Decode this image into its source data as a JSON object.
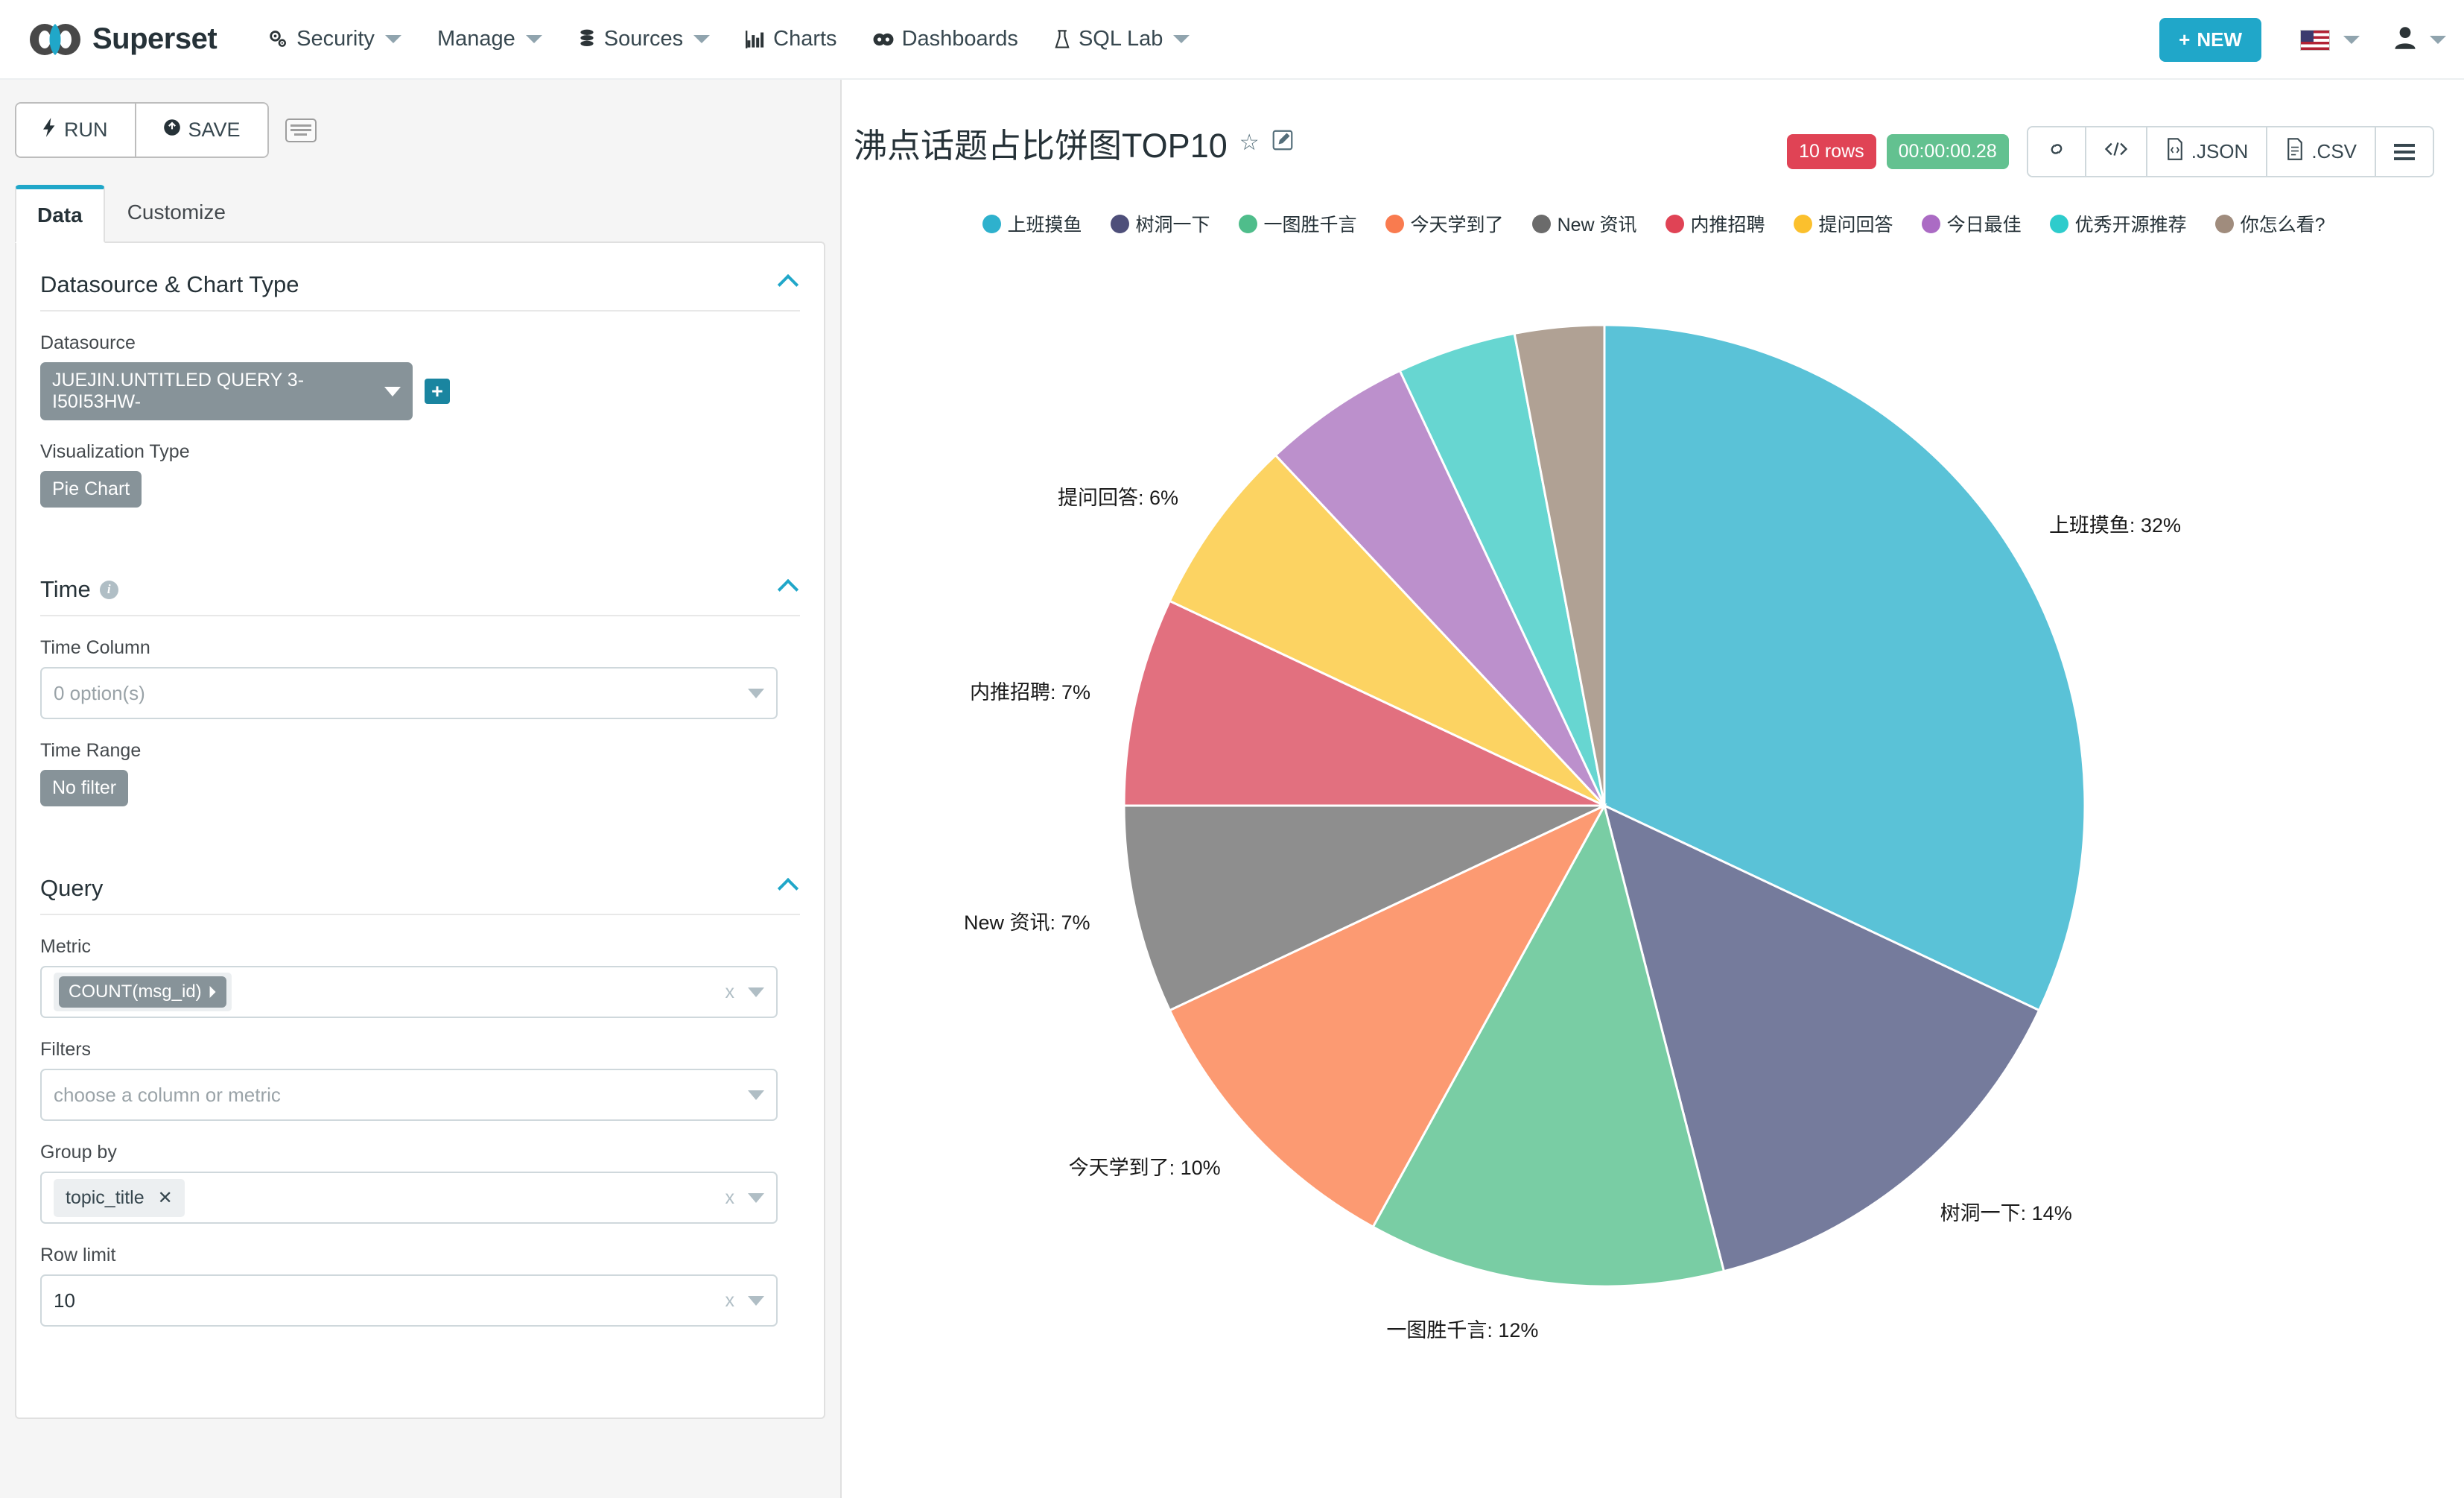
{
  "navbar": {
    "brand": "Superset",
    "items": [
      {
        "label": "Security",
        "icon": "gears-icon",
        "caret": true
      },
      {
        "label": "Manage",
        "icon": null,
        "caret": true
      },
      {
        "label": "Sources",
        "icon": "database-icon",
        "caret": true
      },
      {
        "label": "Charts",
        "icon": "bar-chart-icon",
        "caret": false
      },
      {
        "label": "Dashboards",
        "icon": "dashboard-icon",
        "caret": false
      },
      {
        "label": "SQL Lab",
        "icon": "flask-icon",
        "caret": true
      }
    ],
    "new_button": "NEW",
    "new_button_plus": "+",
    "language_icon": "us-flag-icon",
    "user_icon": "person-icon"
  },
  "left_panel": {
    "run_label": "RUN",
    "save_label": "SAVE",
    "keyboard_shortcut_icon": "keyboard-icon",
    "tabs": [
      {
        "label": "Data",
        "active": true
      },
      {
        "label": "Customize",
        "active": false
      }
    ],
    "sections": {
      "datasource": {
        "title": "Datasource & Chart Type",
        "datasource_label": "Datasource",
        "datasource_value": "JUEJIN.UNTITLED QUERY 3-I50I53HW-",
        "add_datasource_icon": "+",
        "viz_type_label": "Visualization Type",
        "viz_type_value": "Pie Chart"
      },
      "time": {
        "title": "Time",
        "time_column_label": "Time Column",
        "time_column_value": "0 option(s)",
        "time_range_label": "Time Range",
        "time_range_value": "No filter"
      },
      "query": {
        "title": "Query",
        "metric_label": "Metric",
        "metric_value": "COUNT(msg_id)",
        "filters_label": "Filters",
        "filters_placeholder": "choose a column or metric",
        "group_by_label": "Group by",
        "group_by_value": "topic_title",
        "row_limit_label": "Row limit",
        "row_limit_value": "10",
        "clear_x": "x"
      }
    }
  },
  "chart_header": {
    "title": "沸点话题占比饼图TOP10",
    "favorite_icon": "star-icon",
    "edit_icon": "edit-pencil-icon",
    "rows_badge": "10 rows",
    "time_badge": "00:00:00.28",
    "tools": [
      {
        "label": "",
        "icon": "link-icon",
        "name": "share-link-button"
      },
      {
        "label": "",
        "icon": "code-icon",
        "name": "view-code-button"
      },
      {
        "label": ".JSON",
        "icon": "json-file-icon",
        "name": "export-json-button"
      },
      {
        "label": ".CSV",
        "icon": "csv-file-icon",
        "name": "export-csv-button"
      },
      {
        "label": "",
        "icon": "hamburger-icon",
        "name": "more-options-button"
      }
    ]
  },
  "chart_data": {
    "type": "pie",
    "title": "沸点话题占比饼图TOP10",
    "legend_position": "top",
    "labels": [
      "上班摸鱼",
      "树洞一下",
      "一图胜千言",
      "今天学到了",
      "New 资讯",
      "内推招聘",
      "提问回答",
      "今日最佳",
      "优秀开源推荐",
      "你怎么看?"
    ],
    "values": [
      32,
      14,
      12,
      10,
      7,
      7,
      6,
      5,
      4,
      3
    ],
    "value_unit": "%",
    "colors": [
      "#5ac2d7",
      "#757b9c",
      "#79cda4",
      "#fc9a72",
      "#8e8e8e",
      "#e2707f",
      "#fcd362",
      "#bc90cc",
      "#67d6d1",
      "#b0a194"
    ],
    "slice_labels": [
      "上班摸鱼: 32%",
      "树洞一下: 14%",
      "一图胜千言: 12%",
      "今天学到了: 10%",
      "New 资讯: 7%",
      "内推招聘: 7%",
      "提问回答: 6%"
    ],
    "legend_entries": [
      {
        "label": "上班摸鱼",
        "color": "#2eb1cd"
      },
      {
        "label": "树洞一下",
        "color": "#4e4f7a"
      },
      {
        "label": "一图胜千言",
        "color": "#4fbd8b"
      },
      {
        "label": "今天学到了",
        "color": "#f97b4f"
      },
      {
        "label": "New 资讯",
        "color": "#6b6b6b"
      },
      {
        "label": "内推招聘",
        "color": "#e04355"
      },
      {
        "label": "提问回答",
        "color": "#fbc02d"
      },
      {
        "label": "今日最佳",
        "color": "#ab6bc4"
      },
      {
        "label": "优秀开源推荐",
        "color": "#2ecccc"
      },
      {
        "label": "你怎么看?",
        "color": "#a08c7d"
      }
    ]
  }
}
